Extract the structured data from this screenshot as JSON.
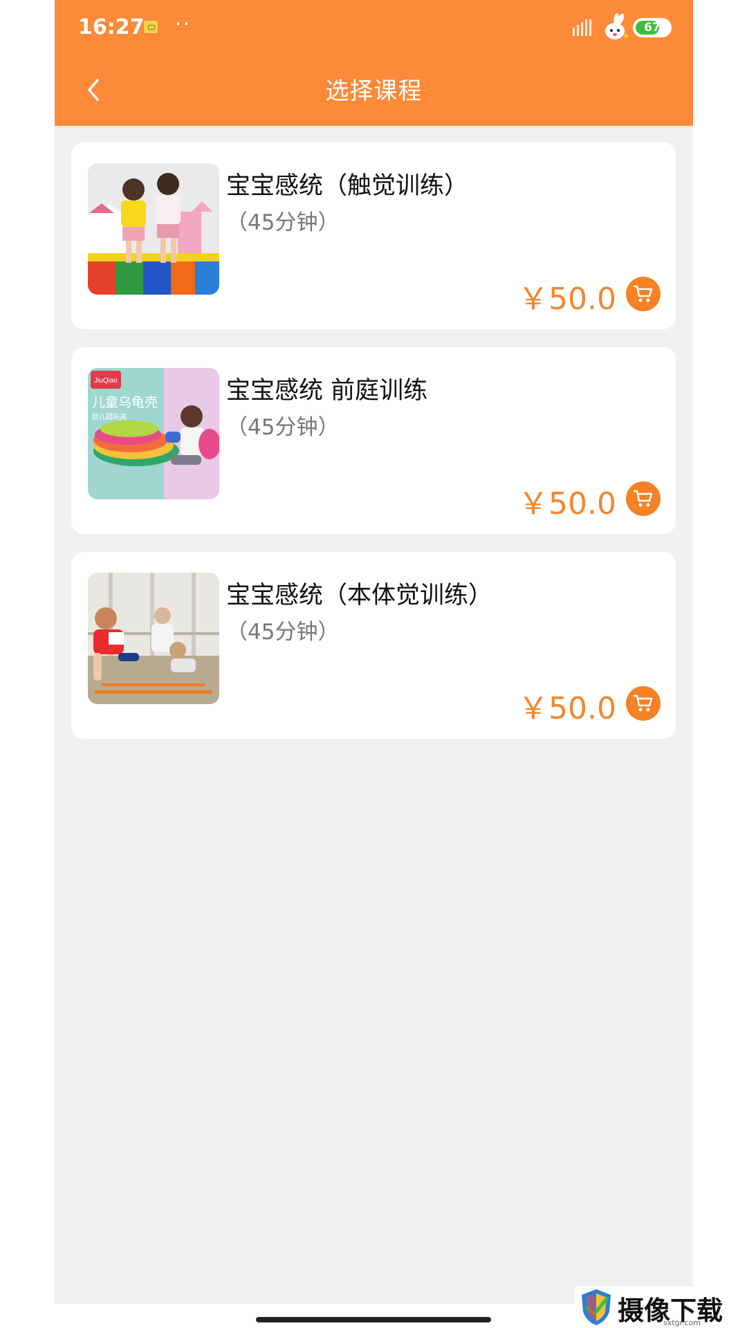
{
  "status_bar": {
    "time": "16:27",
    "dots": "··",
    "battery": "67"
  },
  "header": {
    "title": "选择课程",
    "back_icon": "chevron-left-icon"
  },
  "courses": [
    {
      "name": "宝宝感统（触觉训练）",
      "duration": "（45分钟）",
      "price": "￥50.0",
      "cart_icon": "cart-icon"
    },
    {
      "name": "宝宝感统 前庭训练",
      "duration": "（45分钟）",
      "price": "￥50.0",
      "cart_icon": "cart-icon",
      "thumb_text": {
        "brand": "JiuQiao",
        "title": "儿童乌龟壳",
        "sub": "幼儿园玩具"
      }
    },
    {
      "name": "宝宝感统（本体觉训练）",
      "duration": "（45分钟）",
      "price": "￥50.0",
      "cart_icon": "cart-icon"
    }
  ],
  "watermark": {
    "text": "摄像下载站",
    "url": "sxtgr.com"
  },
  "colors": {
    "accent": "#fc8a38",
    "price": "#f2862f",
    "background": "#f0f0f0"
  }
}
